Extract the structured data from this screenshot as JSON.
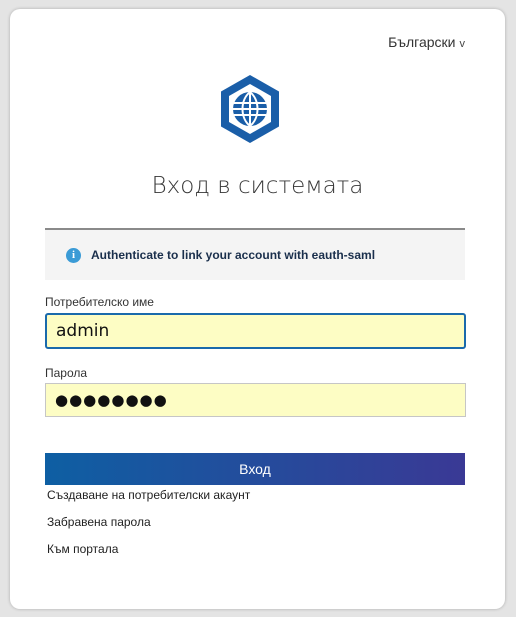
{
  "header": {
    "language": "Български",
    "language_chevron": "v"
  },
  "logo": {
    "name": "hexagon-globe-logo",
    "color": "#1a5ea8"
  },
  "page": {
    "title": "Вход в системата"
  },
  "alert": {
    "icon": "info-icon",
    "icon_glyph": "i",
    "message": "Authenticate to link your account with eauth-saml"
  },
  "form": {
    "username_label": "Потребителско име",
    "username_value": "admin",
    "password_label": "Парола",
    "password_value": "●●●●●●●●",
    "submit_label": "Вход"
  },
  "links": {
    "create_account": "Създаване на потребителски акаунт",
    "forgot_password": "Забравена парола",
    "to_portal": "Към портала"
  },
  "colors": {
    "accent": "#1a6aac",
    "button_gradient_start": "#0e5fa3",
    "button_gradient_end": "#3a3995",
    "autofill_background": "#fdfdc4"
  }
}
